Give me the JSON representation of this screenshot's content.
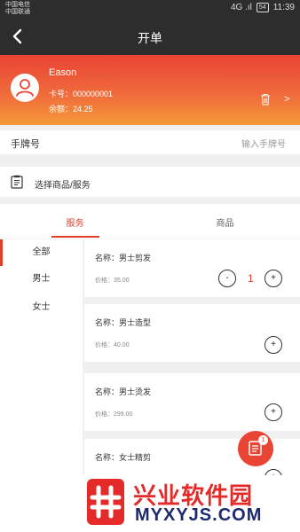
{
  "statusbar": {
    "carrier1": "中国电信",
    "carrier2": "中国联通",
    "signal": "4G .ıl",
    "battery": "54",
    "time": "11:39"
  },
  "topbar": {
    "title": "开单",
    "back_icon": "chevron-left-icon"
  },
  "member": {
    "name": "Eason",
    "card_number": "卡号：000000001",
    "balance": "余额：24.25",
    "avatar_icon": "user-icon",
    "delete_icon": "trash-icon",
    "detail_arrow": ">"
  },
  "plate": {
    "label": "手牌号",
    "placeholder": "输入手牌号"
  },
  "choose": {
    "label": "选择商品/服务",
    "icon": "clipboard-icon"
  },
  "tabs": [
    {
      "label": "服务",
      "active": true
    },
    {
      "label": "商品",
      "active": false
    }
  ],
  "categories": [
    {
      "label": "全部",
      "active": true
    },
    {
      "label": "男士",
      "active": false
    },
    {
      "label": "女士",
      "active": false
    }
  ],
  "items": [
    {
      "name": "名称：男士剪发",
      "price": "价格：35.00",
      "qty": "1"
    },
    {
      "name": "名称：男士造型",
      "price": "价格：40.00"
    },
    {
      "name": "名称：男士烫发",
      "price": "价格：299.00"
    },
    {
      "name": "名称：女士精剪",
      "price": ""
    }
  ],
  "controls": {
    "minus": "-",
    "plus": "+"
  },
  "cart": {
    "badge": "1",
    "icon": "cart-list-icon"
  },
  "watermark": {
    "cn": "兴业软件园",
    "en": "MYXYJS.COM"
  },
  "colors": {
    "accent": "#e0402a",
    "header_start": "#e94434",
    "header_end": "#f5983a"
  }
}
